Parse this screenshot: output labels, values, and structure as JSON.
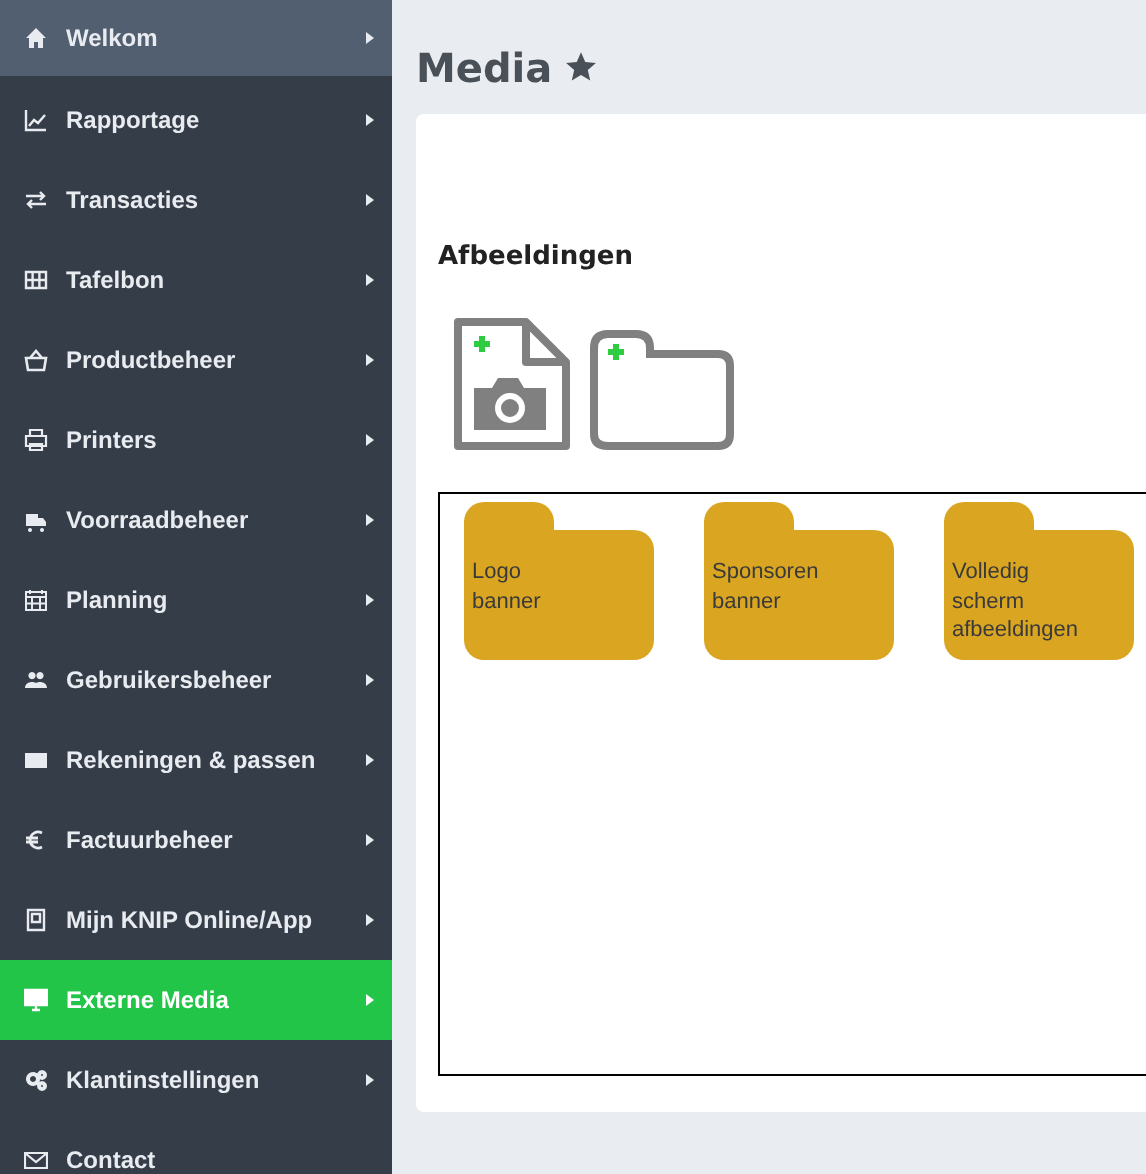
{
  "sidebar": {
    "items": [
      {
        "label": "Welkom",
        "highlighted": true,
        "selected": false,
        "submenu": true
      },
      {
        "label": "Rapportage",
        "highlighted": false,
        "selected": false,
        "submenu": true
      },
      {
        "label": "Transacties",
        "highlighted": false,
        "selected": false,
        "submenu": true
      },
      {
        "label": "Tafelbon",
        "highlighted": false,
        "selected": false,
        "submenu": true
      },
      {
        "label": "Productbeheer",
        "highlighted": false,
        "selected": false,
        "submenu": true
      },
      {
        "label": "Printers",
        "highlighted": false,
        "selected": false,
        "submenu": true
      },
      {
        "label": "Voorraadbeheer",
        "highlighted": false,
        "selected": false,
        "submenu": true
      },
      {
        "label": "Planning",
        "highlighted": false,
        "selected": false,
        "submenu": true
      },
      {
        "label": "Gebruikersbeheer",
        "highlighted": false,
        "selected": false,
        "submenu": true
      },
      {
        "label": "Rekeningen & passen",
        "highlighted": false,
        "selected": false,
        "submenu": true
      },
      {
        "label": "Factuurbeheer",
        "highlighted": false,
        "selected": false,
        "submenu": true
      },
      {
        "label": "Mijn KNIP Online/App",
        "highlighted": false,
        "selected": false,
        "submenu": true
      },
      {
        "label": "Externe Media",
        "highlighted": false,
        "selected": true,
        "submenu": true
      },
      {
        "label": "Klantinstellingen",
        "highlighted": false,
        "selected": false,
        "submenu": true
      },
      {
        "label": "Contact",
        "highlighted": false,
        "selected": false,
        "submenu": false
      }
    ]
  },
  "page": {
    "title": "Media"
  },
  "section": {
    "title": "Afbeeldingen"
  },
  "folders": [
    {
      "label": "Logo banner"
    },
    {
      "label": "Sponsoren banner"
    },
    {
      "label": "Volledig scherm afbeeldingen"
    }
  ]
}
